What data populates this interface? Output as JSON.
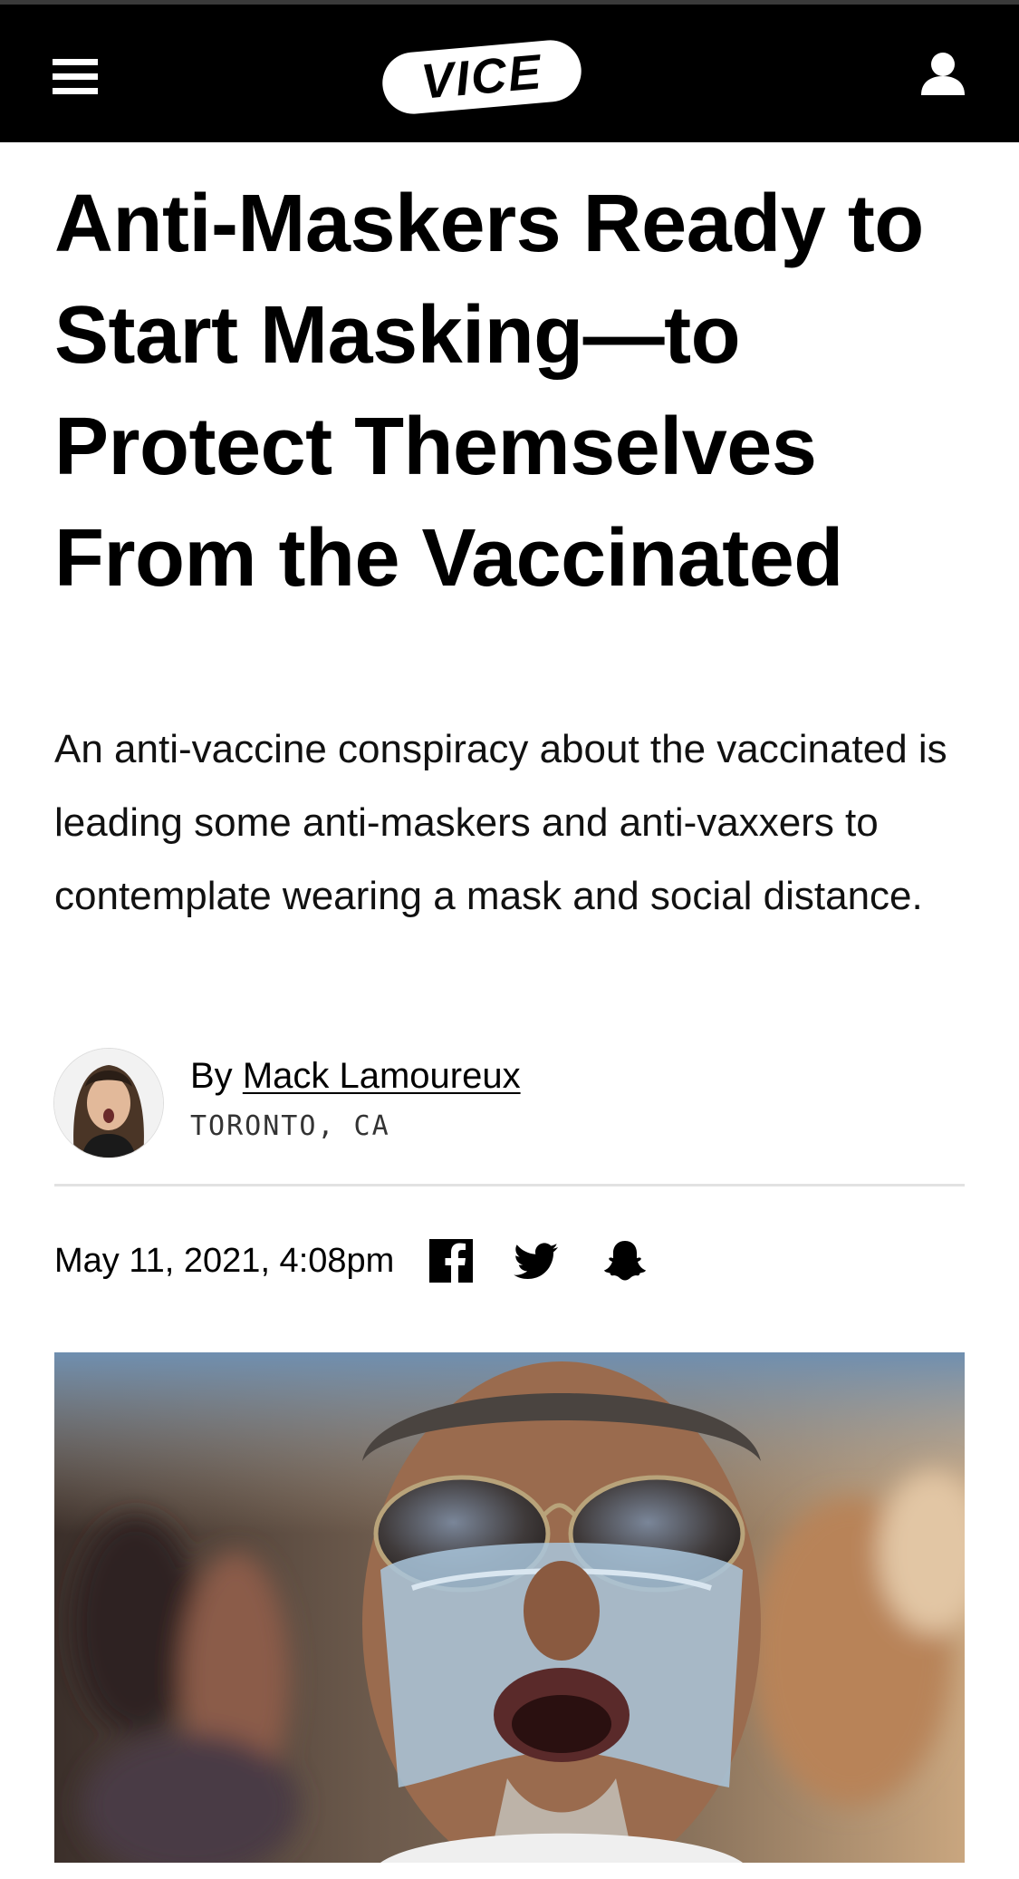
{
  "header": {
    "menu_icon": "hamburger-menu-icon",
    "logo_text": "VICE",
    "account_icon": "user-icon"
  },
  "article": {
    "headline": "Anti-Maskers Ready to Start Masking—to Protect Themselves From the Vaccinated",
    "dek": "An anti-vaccine conspiracy about the vaccinated is leading some anti-maskers and anti-vaxxers to contemplate wearing a mask and social distance.",
    "byline_prefix": "By",
    "author": "Mack Lamoureux",
    "location": "TORONTO, CA",
    "date": "May 11, 2021, 4:08pm"
  },
  "share": {
    "icons": [
      "facebook-icon",
      "twitter-icon",
      "snapchat-icon"
    ]
  },
  "colors": {
    "header_bg": "#000000",
    "text": "#000000",
    "divider": "#e2e2e2"
  }
}
